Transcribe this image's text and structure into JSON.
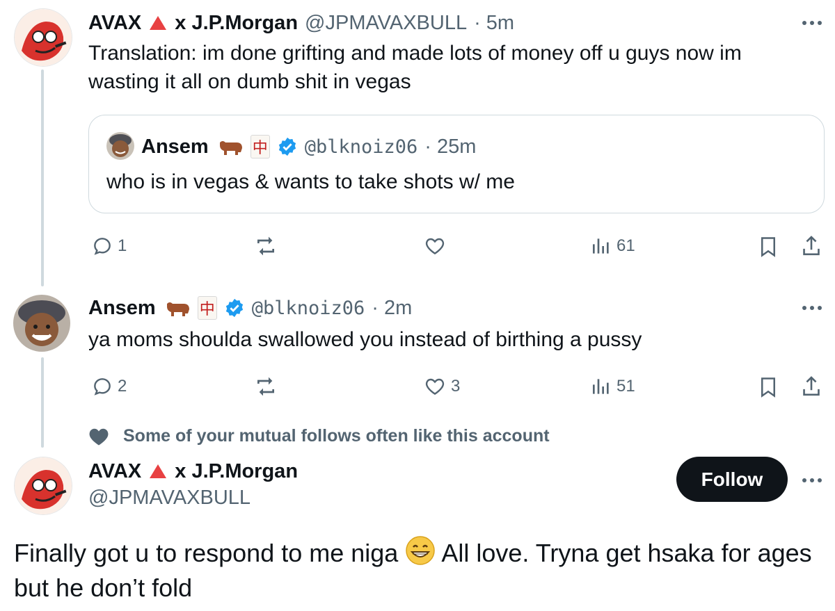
{
  "colors": {
    "text": "#0f1419",
    "muted": "#536471",
    "border": "#cfd9de",
    "verified": "#1d9bf0",
    "follow_bg": "#0f1419",
    "red_mark": "#e0245e"
  },
  "tweet1": {
    "display_name": "AVAX",
    "name_suffix": "x J.P.Morgan",
    "handle": "@JPMAVAXBULL",
    "time": "· 5m",
    "text": "Translation: im done grifting and made lots of money off u guys now im wasting it all on dumb shit in vegas",
    "quote": {
      "display_name": "Ansem",
      "handle": "@blknoiz06",
      "time": "· 25m",
      "text": "who is in vegas & wants to take shots w/ me"
    },
    "actions": {
      "replies": "1",
      "reposts": "",
      "likes": "",
      "views": "61"
    },
    "icons": [
      "reply-icon",
      "repost-icon",
      "like-icon",
      "views-icon",
      "bookmark-icon",
      "share-icon"
    ]
  },
  "tweet2": {
    "display_name": "Ansem",
    "handle": "@blknoiz06",
    "time": "· 2m",
    "text": "ya moms shoulda swallowed you instead of birthing a pussy",
    "actions": {
      "replies": "2",
      "reposts": "",
      "likes": "3",
      "views": "51"
    }
  },
  "social_context": "Some of your mutual follows often like this account",
  "profile": {
    "display_name": "AVAX",
    "name_suffix": "x J.P.Morgan",
    "handle": "@JPMAVAXBULL",
    "follow_label": "Follow"
  },
  "final_post": {
    "part1": "Finally got u to respond to me niga",
    "part2": " All love. Tryna get hsaka for ages but he don’t fold"
  }
}
